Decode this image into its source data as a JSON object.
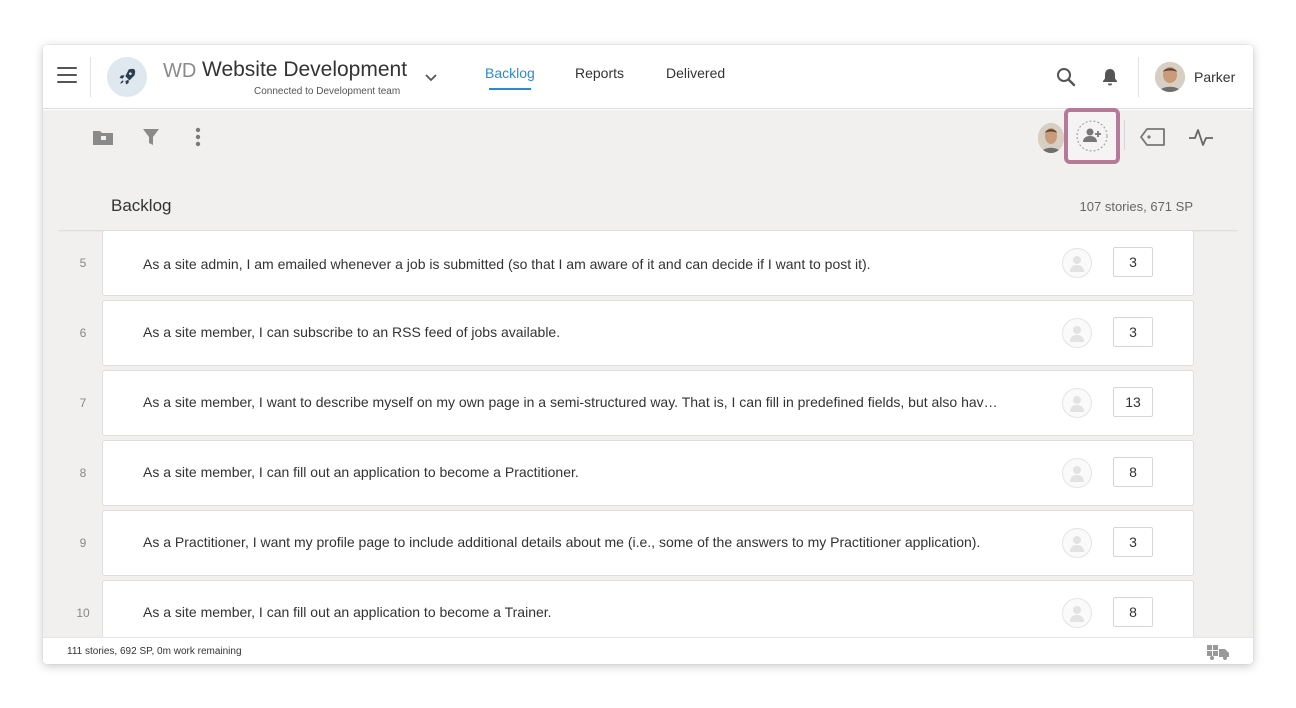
{
  "header": {
    "project_abbr": "WD",
    "project_name": "Website Development",
    "project_subtitle": "Connected to Development team",
    "tabs": [
      {
        "label": "Backlog",
        "active": true
      },
      {
        "label": "Reports",
        "active": false
      },
      {
        "label": "Delivered",
        "active": false
      }
    ],
    "user_name": "Parker",
    "icons": [
      "menu-icon",
      "rocket-icon",
      "chevron-down-icon",
      "search-icon",
      "bell-icon"
    ]
  },
  "toolbar": {
    "icons": [
      "folder-icon",
      "filter-icon",
      "more-vertical-icon",
      "assign-user-icon",
      "tag-icon",
      "activity-icon"
    ]
  },
  "backlog": {
    "title": "Backlog",
    "summary": "107 stories, 671 SP",
    "stories": [
      {
        "num": "5",
        "text": "As a site admin, I am emailed whenever a job is submitted (so that I am aware of it and can decide if I want to post it).",
        "sp": "3"
      },
      {
        "num": "6",
        "text": "As a site member, I can subscribe to an RSS feed of jobs available.",
        "sp": "3"
      },
      {
        "num": "7",
        "text": "As a site member, I want to describe myself on my own page in a semi-structured way. That is, I can fill in predefined fields, but also hav…",
        "sp": "13"
      },
      {
        "num": "8",
        "text": "As a site member, I can fill out an application to become a Practitioner.",
        "sp": "8"
      },
      {
        "num": "9",
        "text": "As a Practitioner, I want my profile page to include additional details about me (i.e., some of the answers to my Practitioner application).",
        "sp": "3"
      },
      {
        "num": "10",
        "text": "As a site member, I can fill out an application to become a Trainer.",
        "sp": "8"
      }
    ]
  },
  "status": {
    "text": "111 stories, 692 SP, 0m work remaining"
  },
  "colors": {
    "accent": "#2a8ad6",
    "highlight": "#b67a98",
    "background": "#f1f0ef"
  }
}
